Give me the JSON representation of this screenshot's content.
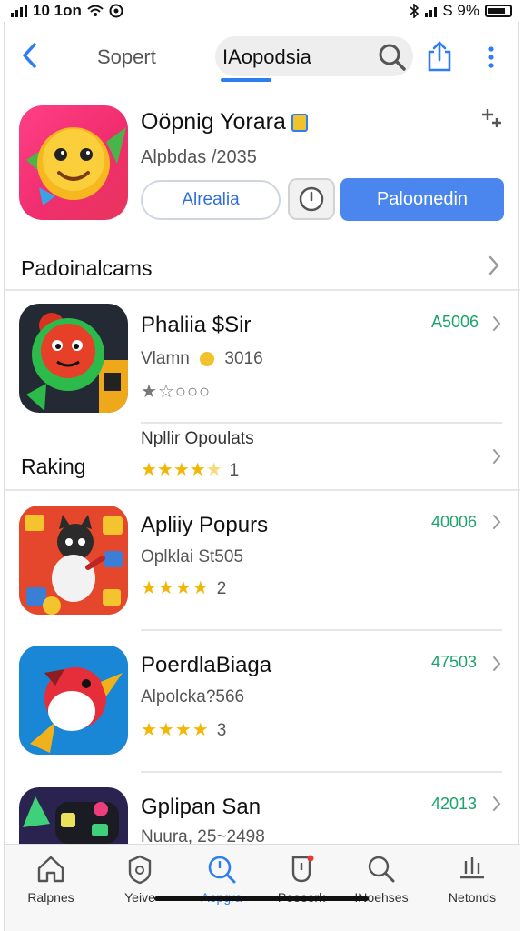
{
  "status": {
    "left_text": "10 1on",
    "battery": "S 9%"
  },
  "nav": {
    "tab1": "Sopert",
    "tab2": "IAopodsia",
    "icons": [
      "back-chevron-icon",
      "search-icon",
      "share-icon",
      "more-vertical-icon"
    ]
  },
  "hero": {
    "title": "Oöpnig Yorara",
    "subtitle": "Alpbdas /2035",
    "button_outline": "Alrealia",
    "button_primary": "Paloonedin"
  },
  "section": {
    "title": "Padoinalcams"
  },
  "apps": [
    {
      "title": "Phaliia $Sir",
      "sub": "Vlamn",
      "sub_extra": "3016",
      "price": "A5006",
      "stars_on": 1,
      "stars_total": 5,
      "rating_text": ""
    },
    {
      "title": "Apliiy Popurs",
      "sub": "Oplklai St505",
      "price": "40006",
      "stars_on": 4,
      "stars_total": 4,
      "rating_text": "2"
    },
    {
      "title": "PoerdlaBiaga",
      "sub": "Alpolcka?566",
      "price": "47503",
      "stars_on": 4,
      "stars_total": 4,
      "rating_text": "3"
    },
    {
      "title": "Gplipan San",
      "sub": "Nuura, 25~2498",
      "price": "42013"
    }
  ],
  "ranking": {
    "label": "Raking",
    "subtitle": "Npllir Opoulats",
    "stars_on": 4,
    "stars_total": 5,
    "rating_text": "1"
  },
  "tabbar": {
    "tabs": [
      {
        "label": "Ralpnes",
        "icon": "home-icon"
      },
      {
        "label": "Yeive",
        "icon": "badge-icon"
      },
      {
        "label": "Aopgra",
        "icon": "search-icon",
        "active": true
      },
      {
        "label": "Peoeerk",
        "icon": "bookmark-icon"
      },
      {
        "label": "INoehses",
        "icon": "search-icon"
      },
      {
        "label": "Netonds",
        "icon": "chart-icon"
      }
    ]
  },
  "colors": {
    "accent": "#2f7ef1",
    "primary_button": "#4a86ee",
    "price_green": "#1aa36b",
    "star": "#f2b705"
  }
}
